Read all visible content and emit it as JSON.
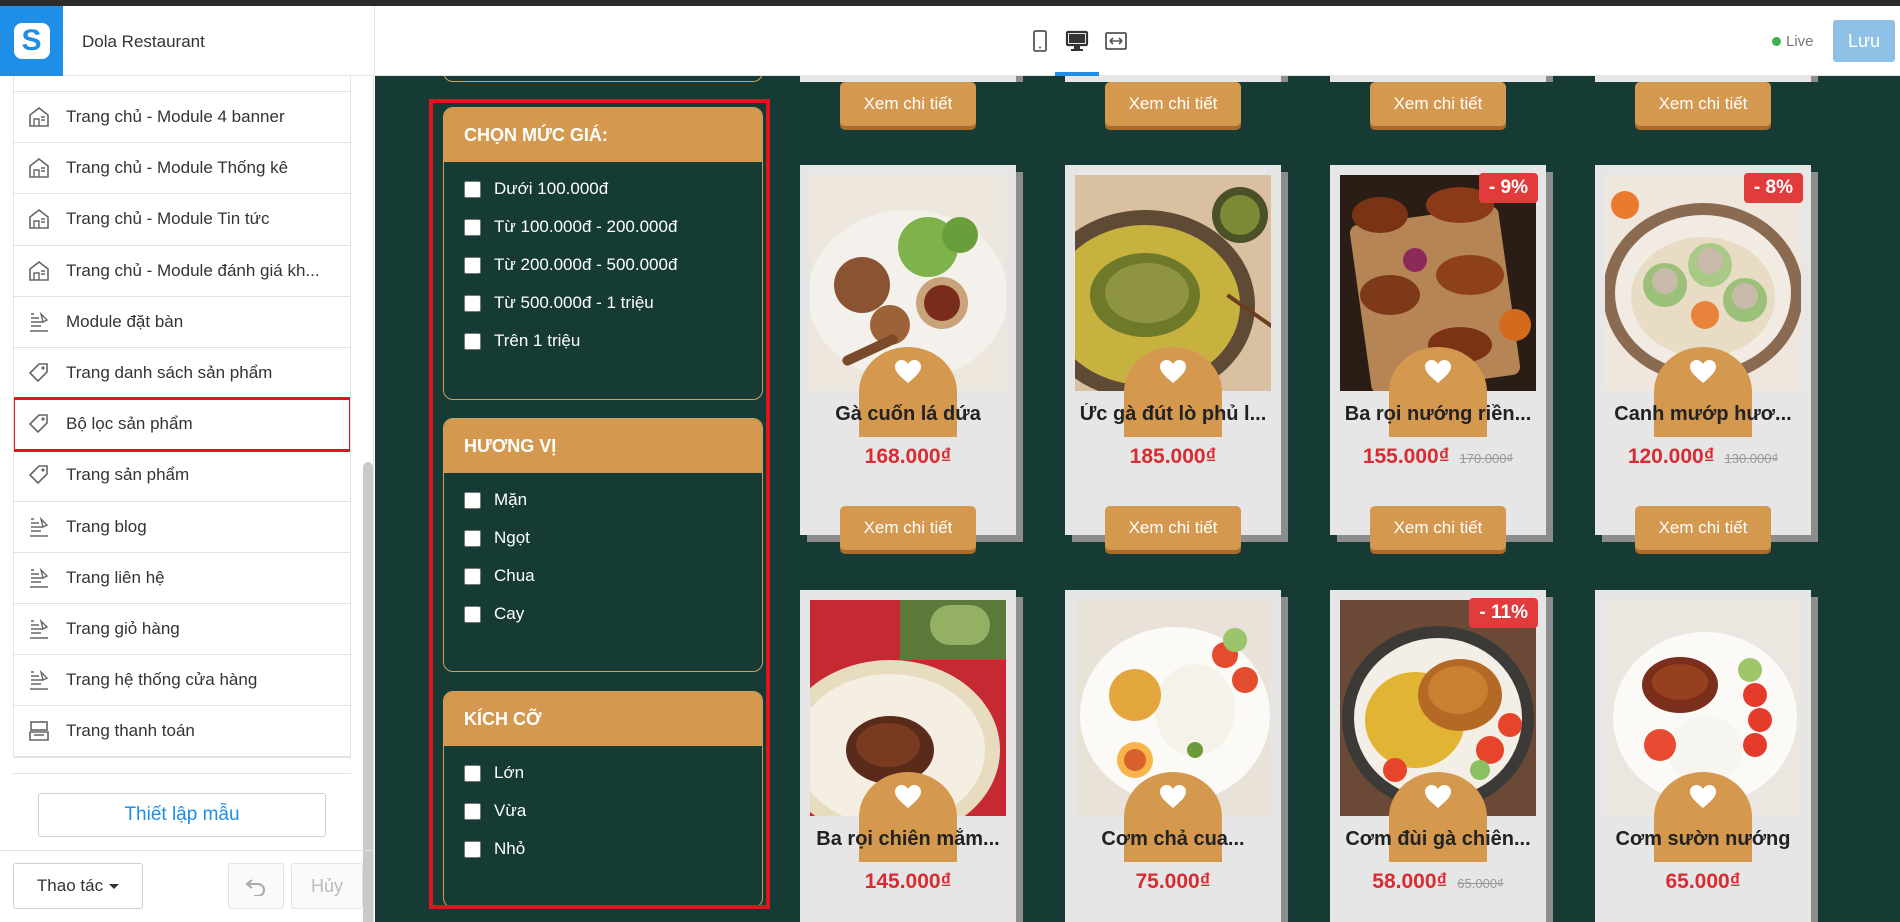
{
  "header": {
    "site_name": "Dola Restaurant",
    "live_label": "Live",
    "save_label": "Lưu",
    "devices": [
      "mobile-icon",
      "desktop-icon",
      "fullwidth-icon"
    ],
    "active_device": "desktop"
  },
  "sidebar": {
    "items": [
      {
        "label": "",
        "icon": "layout-icon"
      },
      {
        "label": "Trang chủ - Module 4 banner",
        "icon": "layout-icon"
      },
      {
        "label": "Trang chủ - Module Thống kê",
        "icon": "layout-icon"
      },
      {
        "label": "Trang chủ - Module Tin tức",
        "icon": "layout-icon"
      },
      {
        "label": "Trang chủ - Module đánh giá kh...",
        "icon": "layout-icon"
      },
      {
        "label": "Module đặt bàn",
        "icon": "page-icon"
      },
      {
        "label": "Trang danh sách sản phẩm",
        "icon": "tag-icon"
      },
      {
        "label": "Bộ lọc sản phẩm",
        "icon": "tag-icon",
        "selected": true
      },
      {
        "label": "Trang sản phẩm",
        "icon": "tag-icon"
      },
      {
        "label": "Trang blog",
        "icon": "page-icon"
      },
      {
        "label": "Trang liên hệ",
        "icon": "page-icon"
      },
      {
        "label": "Trang giỏ hàng",
        "icon": "page-icon"
      },
      {
        "label": "Trang hệ thống cửa hàng",
        "icon": "page-icon"
      },
      {
        "label": "Trang thanh toán",
        "icon": "register-icon"
      }
    ],
    "template_button": "Thiết lập mẫu",
    "action_button": "Thao tác",
    "cancel_button": "Hủy"
  },
  "filters": [
    {
      "title": "CHỌN MỨC GIÁ:",
      "options": [
        "Dưới 100.000đ",
        "Từ 100.000đ - 200.000đ",
        "Từ 200.000đ - 500.000đ",
        "Từ 500.000đ - 1 triệu",
        "Trên 1 triệu"
      ]
    },
    {
      "title": "HƯƠNG VỊ",
      "options": [
        "Mặn",
        "Ngọt",
        "Chua",
        "Cay"
      ]
    },
    {
      "title": "KÍCH CỠ",
      "options": [
        "Lớn",
        "Vừa",
        "Nhỏ"
      ]
    }
  ],
  "detail_label": "Xem chi tiết",
  "products": [
    {
      "name": "Gà cuốn lá dứa",
      "price": "168.000₫",
      "old_price": "",
      "discount": ""
    },
    {
      "name": "Ức gà đút lò phủ l...",
      "price": "185.000₫",
      "old_price": "",
      "discount": ""
    },
    {
      "name": "Ba rọi nướng riền...",
      "price": "155.000₫",
      "old_price": "170.000₫",
      "discount": "- 9%"
    },
    {
      "name": "Canh mướp hươ...",
      "price": "120.000₫",
      "old_price": "130.000₫",
      "discount": "- 8%"
    },
    {
      "name": "Ba rọi chiên mắm...",
      "price": "145.000₫",
      "old_price": "",
      "discount": ""
    },
    {
      "name": "Cơm chả cua...",
      "price": "75.000₫",
      "old_price": "",
      "discount": ""
    },
    {
      "name": "Cơm đùi gà chiên...",
      "price": "58.000₫",
      "old_price": "65.000₫",
      "discount": "- 11%"
    },
    {
      "name": "Cơm sườn nướng",
      "price": "65.000₫",
      "old_price": "",
      "discount": ""
    }
  ],
  "colors": {
    "accent": "#1e8ee6",
    "preview_bg": "#163a34",
    "gold": "#d4994f",
    "price_red": "#d92c32",
    "highlight": "#e0141e"
  }
}
